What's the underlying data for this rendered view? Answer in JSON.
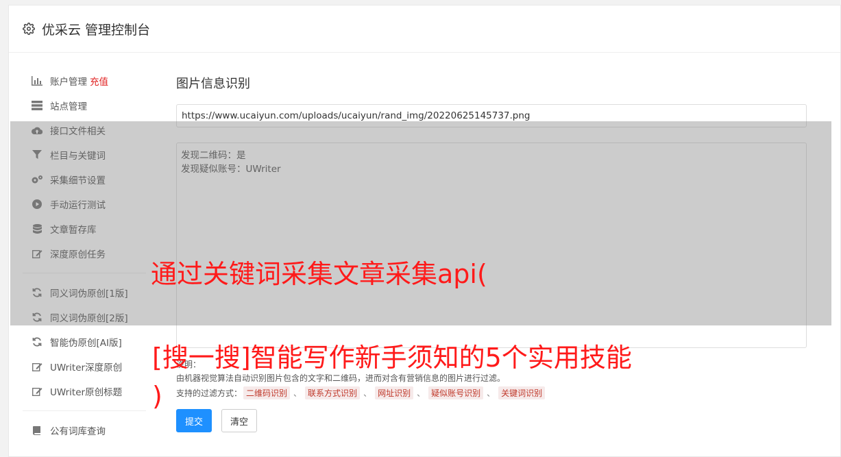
{
  "header": {
    "title": "优采云 管理控制台",
    "icon": "gear-icon"
  },
  "sidebar": {
    "items": [
      {
        "label": "账户管理",
        "extra": "充值",
        "icon": "bar-chart-icon"
      },
      {
        "label": "站点管理",
        "icon": "server-icon"
      },
      {
        "label": "接口文件相关",
        "icon": "cloud-upload-icon"
      },
      {
        "label": "栏目与关键词",
        "icon": "filter-icon"
      },
      {
        "label": "采集细节设置",
        "icon": "gears-icon"
      },
      {
        "label": "手动运行测试",
        "icon": "play-icon"
      },
      {
        "label": "文章暂存库",
        "icon": "database-icon"
      },
      {
        "label": "深度原创任务",
        "icon": "edit-icon"
      },
      {
        "label": "同义词伪原创[1版]",
        "icon": "refresh-icon"
      },
      {
        "label": "同义词伪原创[2版]",
        "icon": "refresh-icon"
      },
      {
        "label": "智能伪原创[AI版]",
        "icon": "refresh-icon"
      },
      {
        "label": "UWriter深度原创",
        "icon": "edit-icon"
      },
      {
        "label": "UWriter原创标题",
        "icon": "edit-icon"
      },
      {
        "label": "公有词库查询",
        "icon": "book-icon"
      }
    ]
  },
  "main": {
    "title": "图片信息识别",
    "url_value": "https://www.ucaiyun.com/uploads/ucaiyun/rand_img/20220625145737.png",
    "result_lines": [
      "发现二维码：是",
      "发现疑似账号：UWriter"
    ],
    "hint_label": "说明：",
    "hint_text": "由机器视觉算法自动识别图片包含的文字和二维码，进而对含有营销信息的图片进行过滤。",
    "filters_label": "支持的过滤方式：",
    "filters": [
      "二维码识别",
      "联系方式识别",
      "网址识别",
      "疑似账号识别",
      "关键词识别"
    ],
    "filter_sep": "、",
    "submit_label": "提交",
    "clear_label": "清空"
  },
  "overlay": {
    "line1": "通过关键词采集文章采集api(",
    "line2": "[搜一搜]智能写作新手须知的5个实用技能",
    "line3": ")"
  },
  "colors": {
    "accent": "#1e90ff",
    "danger": "#e02020",
    "overlay_text": "#ff1a1a"
  }
}
